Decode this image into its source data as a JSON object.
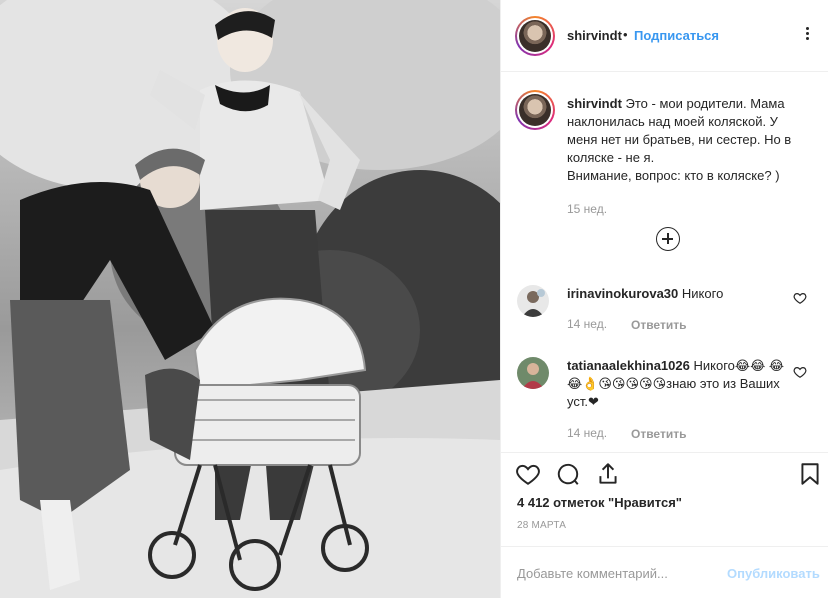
{
  "post": {
    "username": "shirvindt",
    "separator": "•",
    "follow_label": "Подписаться",
    "caption_user": "shirvindt",
    "caption_lines": [
      "Это - мои родители. Мама",
      "наклонилась над моей коляской. У",
      "меня нет ни братьев, ни сестер. Но в",
      "коляске - не я.",
      "Внимание, вопрос: кто в коляске? )"
    ],
    "caption_time": "15 нед."
  },
  "comments": [
    {
      "user": "irinavinokurova30",
      "lines": [
        "Никого"
      ],
      "time": "14 нед.",
      "reply_label": "Ответить"
    },
    {
      "user": "tatianaalekhina1026",
      "lines": [
        "Никого😂😂",
        "😂😂👌😘😘😘😘😘знаю это из",
        "Ваших уст.❤"
      ],
      "time": "14 нед.",
      "reply_label": "Ответить"
    }
  ],
  "actions": {
    "like_icon": "heart-icon",
    "comment_icon": "comment-icon",
    "share_icon": "share-icon",
    "save_icon": "bookmark-icon"
  },
  "likes_text": "4 412 отметок \"Нравится\"",
  "date_text": "28 МАРТА",
  "add_comment": {
    "placeholder": "Добавьте комментарий...",
    "post_label": "Опубликовать"
  },
  "colors": {
    "link": "#3897f0",
    "post_disabled": "#b3dbff",
    "muted": "#999999",
    "text": "#262626"
  }
}
